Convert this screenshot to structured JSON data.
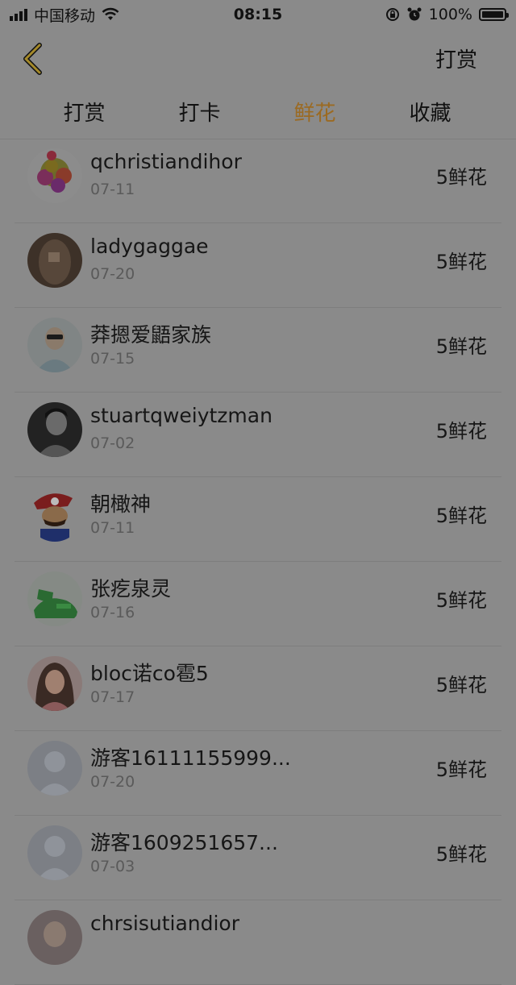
{
  "status_bar": {
    "carrier": "中国移动",
    "time": "08:15",
    "battery": "100%",
    "icons": [
      "signal-icon",
      "wifi-icon",
      "rotation-lock-icon",
      "alarm-icon",
      "battery-icon"
    ]
  },
  "nav": {
    "back_icon": "chevron-left-icon",
    "right_action": "打赏"
  },
  "tabs": [
    {
      "label": "打赏",
      "active": false
    },
    {
      "label": "打卡",
      "active": false
    },
    {
      "label": "鲜花",
      "active": true
    },
    {
      "label": "收藏",
      "active": false
    }
  ],
  "colors": {
    "accent": "#9b6a22",
    "overlay_bg": "#8a8a8a"
  },
  "list": [
    {
      "name": "qchristiandihor",
      "date": "07-11",
      "amount": "5鲜花",
      "avatar": "flowers"
    },
    {
      "name": "ladygaggae",
      "date": "07-20",
      "amount": "5鲜花",
      "avatar": "brown"
    },
    {
      "name": "莽摁爱鼯家族",
      "date": "07-15",
      "amount": "5鲜花",
      "avatar": "man-glasses"
    },
    {
      "name": "stuartqweiytzman",
      "date": "07-02",
      "amount": "5鲜花",
      "avatar": "bw-man"
    },
    {
      "name": "朝橄神",
      "date": "07-11",
      "amount": "5鲜花",
      "avatar": "mario"
    },
    {
      "name": "张疙泉灵",
      "date": "07-16",
      "amount": "5鲜花",
      "avatar": "green"
    },
    {
      "name": "bloc诺co雹5",
      "date": "07-17",
      "amount": "5鲜花",
      "avatar": "woman"
    },
    {
      "name": "游客16111155999...",
      "date": "07-20",
      "amount": "5鲜花",
      "avatar": "default"
    },
    {
      "name": "游客1609251657...",
      "date": "07-03",
      "amount": "5鲜花",
      "avatar": "default"
    },
    {
      "name": "chrsisutiandior",
      "date": "",
      "amount": "",
      "avatar": "partial"
    }
  ]
}
